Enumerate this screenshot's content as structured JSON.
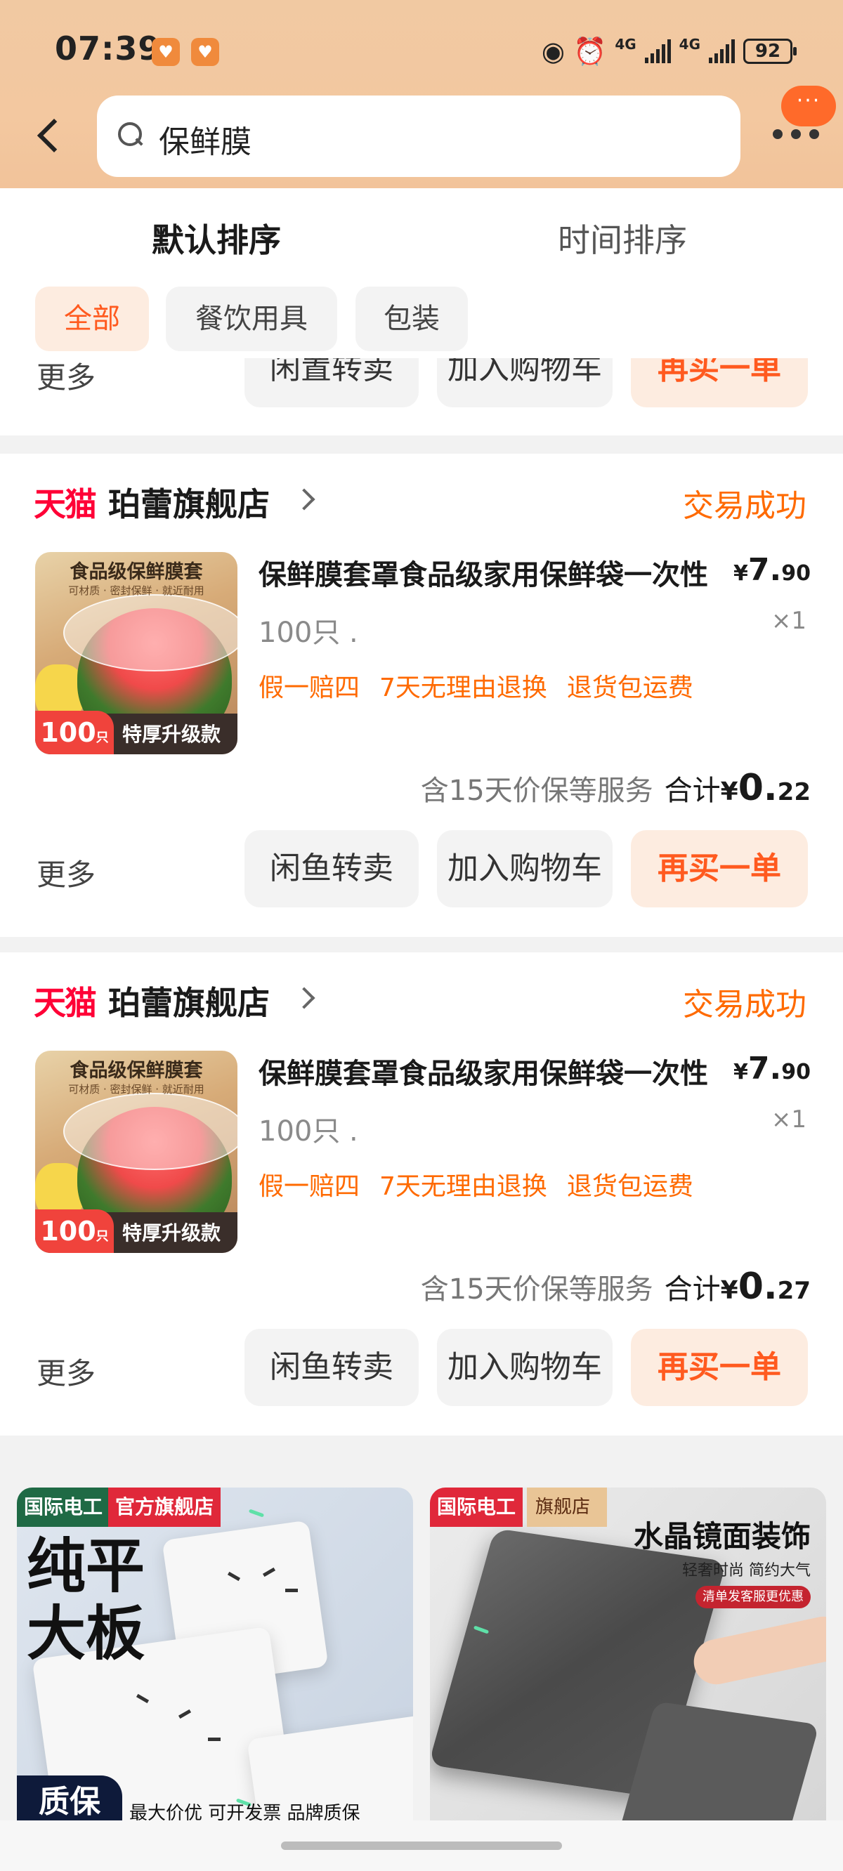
{
  "status_bar": {
    "time": "07:39",
    "network_1": "4G",
    "network_2": "4G",
    "battery": "92"
  },
  "search": {
    "query": "保鲜膜"
  },
  "sort_tabs": [
    {
      "label": "默认排序"
    },
    {
      "label": "时间排序"
    }
  ],
  "chips": [
    {
      "label": "全部"
    },
    {
      "label": "餐饮用具"
    },
    {
      "label": "包装"
    }
  ],
  "partial_order": {
    "more": "更多",
    "resell": "闲置转卖",
    "cart": "加入购物车",
    "buy_again": "再买一单"
  },
  "orders": [
    {
      "platform": "天猫",
      "shop": "珀蕾旗舰店",
      "status": "交易成功",
      "thumb_title": "食品级保鲜膜套",
      "thumb_subtitle": "可材质 · 密封保鲜 · 就近耐用",
      "thumb_count": "100",
      "thumb_unit": "只",
      "thumb_label": "特厚升级款",
      "title": "保鲜膜套罩食品级家用保鲜袋一次性",
      "price_currency": "¥",
      "price_int": "7.",
      "price_dec": "90",
      "quantity": "×1",
      "spec": "100只 .",
      "tags": [
        "假一赔四",
        "7天无理由退换",
        "退货包运费"
      ],
      "service": "含15天价保等服务",
      "total_label": "合计",
      "total_currency": "¥",
      "total_int": "0.",
      "total_dec": "22",
      "more": "更多",
      "resell": "闲鱼转卖",
      "cart": "加入购物车",
      "buy_again": "再买一单"
    },
    {
      "platform": "天猫",
      "shop": "珀蕾旗舰店",
      "status": "交易成功",
      "thumb_title": "食品级保鲜膜套",
      "thumb_subtitle": "可材质 · 密封保鲜 · 就近耐用",
      "thumb_count": "100",
      "thumb_unit": "只",
      "thumb_label": "特厚升级款",
      "title": "保鲜膜套罩食品级家用保鲜袋一次性",
      "price_currency": "¥",
      "price_int": "7.",
      "price_dec": "90",
      "quantity": "×1",
      "spec": "100只 .",
      "tags": [
        "假一赔四",
        "7天无理由退换",
        "退货包运费"
      ],
      "service": "含15天价保等服务",
      "total_label": "合计",
      "total_currency": "¥",
      "total_int": "0.",
      "total_dec": "27",
      "more": "更多",
      "resell": "闲鱼转卖",
      "cart": "加入购物车",
      "buy_again": "再买一单"
    }
  ],
  "recommendations": [
    {
      "badge_1": "国际电工",
      "badge_2": "官方旗舰店",
      "headline_1": "纯平",
      "headline_2": "大板",
      "footer_badge": "质保",
      "footer_text": "最大价优 可开发票 品牌质保"
    },
    {
      "badge_1": "国际电工",
      "badge_2": "旗舰店",
      "headline": "水晶镜面装饰",
      "subline": "轻奢时尚 简约大气",
      "promo": "清单发客服更优惠"
    }
  ]
}
